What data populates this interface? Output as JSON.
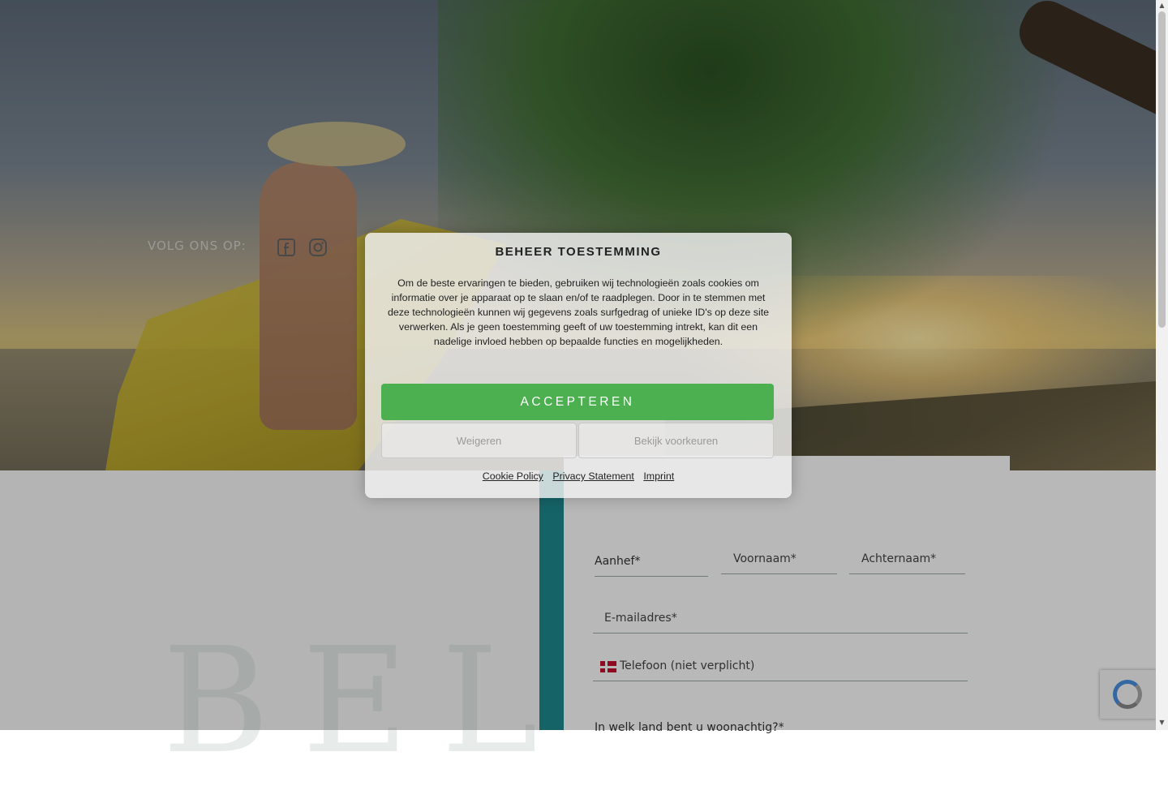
{
  "hero": {
    "follow_label": "VOLG ONS OP:",
    "social_icons": [
      "facebook-icon",
      "instagram-icon"
    ]
  },
  "background_text": "BEL",
  "form": {
    "salutation_label": "Aanhef*",
    "first_name_placeholder": "Voornaam*",
    "last_name_placeholder": "Achternaam*",
    "email_placeholder": "E-mailadres*",
    "phone_placeholder": "Telefoon (niet verplicht)",
    "country_label": "In welk land bent u woonachtig?*",
    "phone_flag": "Denmark"
  },
  "consent": {
    "title": "BEHEER TOESTEMMING",
    "text": "Om de beste ervaringen te bieden, gebruiken wij technologieën zoals cookies om informatie over je apparaat op te slaan en/of te raadplegen. Door in te stemmen met deze technologieën kunnen wij gegevens zoals surfgedrag of unieke ID's op deze site verwerken. Als je geen toestemming geeft of uw toestemming intrekt, kan dit een nadelige invloed hebben op bepaalde functies en mogelijkheden.",
    "accept_label": "ACCEPTEREN",
    "deny_label": "Weigeren",
    "preferences_label": "Bekijk voorkeuren",
    "links": [
      "Cookie Policy",
      "Privacy Statement",
      "Imprint"
    ]
  },
  "colors": {
    "accept_green": "#4caf50",
    "teal_accent": "#1e8a8f",
    "flag_red": "#c8102e"
  }
}
